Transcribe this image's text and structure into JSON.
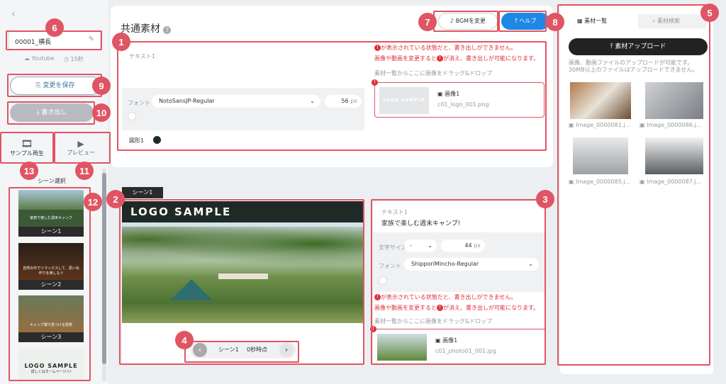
{
  "left": {
    "back_icon": "chevron-left-icon",
    "project_name": "00001_横長",
    "youtube_label": "Youtube",
    "duration_label": "15秒",
    "save_label": "変更を保存",
    "export_label": "書き出し",
    "sample_play_label": "サンプル再生",
    "preview_label": "プレビュー",
    "scene_select_label": "シーン選択",
    "scenes": [
      {
        "label": "シーン1",
        "caption": "家族で楽しむ週末キャンプ"
      },
      {
        "label": "シーン2",
        "caption": "自然の中でリラックスして、思い出作りを楽しもう"
      },
      {
        "label": "シーン3",
        "caption": "キャンプ場で見つける冒険"
      },
      {
        "label": "LOGO SAMPLE",
        "caption": "詳しくはホームページへ!"
      }
    ]
  },
  "main": {
    "title": "共通素材",
    "bgm_label": "BGMを変更",
    "help_label": "ヘルプ",
    "common": {
      "text_label": "テキスト1",
      "font_label": "フォント",
      "font_value": "NotoSansJP-Regular",
      "size_value": "56",
      "size_unit": "px",
      "shape_label": "図形1",
      "warn1_a": "が表示されている状態だと、書き出しができません。",
      "warn2_a": "画像や動画を変更すると",
      "warn2_b": "が消え、書き出しが可能になります。",
      "drop_hint": "素材一覧からここに画像をドラッグ&ドロップ",
      "image_label": "画像1",
      "image_file": "c01_logo_001.png",
      "logo_text": "LOGO SAMPLE"
    },
    "scene_tab": "シーン1",
    "preview_logo": "LOGO SAMPLE",
    "nav_label": "シーン1",
    "nav_time": "0秒時点",
    "scene": {
      "text_label": "テキスト1",
      "text_value": "家族で楽しむ週末キャンプ!",
      "size_label": "文字サイズ",
      "size_sel": "-",
      "size_value": "44",
      "size_unit": "px",
      "font_label": "フォント",
      "font_value": "ShipporiMincho-Regular",
      "warn1_a": "が表示されている状態だと、書き出しができません。",
      "warn2_a": "画像や動画を変更すると",
      "warn2_b": "が消え、書き出しが可能になります。",
      "drop_hint": "素材一覧からここに画像をドラッグ&ドロップ",
      "image_label": "画像1",
      "image_file": "c01_photo01_001.jpg"
    }
  },
  "right": {
    "tab_list": "素材一覧",
    "tab_search": "素材検索",
    "upload_label": "素材アップロード",
    "note": "画像、動画ファイルのアップロードが可能です。30MB以上のファイルはアップロードできません。",
    "items": [
      {
        "name": "Image_0000081.j..."
      },
      {
        "name": "Image_0000086.j..."
      },
      {
        "name": "Image_0000085.j..."
      },
      {
        "name": "Image_0000087.j..."
      }
    ]
  },
  "badges": [
    "1",
    "2",
    "3",
    "4",
    "5",
    "6",
    "7",
    "8",
    "9",
    "10",
    "11",
    "12",
    "13"
  ],
  "colors": {
    "accent": "#e05563",
    "dark": "#1f2a26",
    "help": "#1e88e5"
  }
}
